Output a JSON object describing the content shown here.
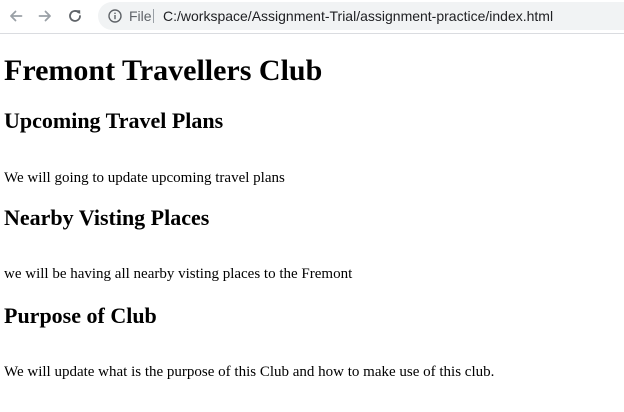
{
  "browser": {
    "back_icon": "arrow-left-icon",
    "forward_icon": "arrow-right-icon",
    "reload_icon": "reload-icon",
    "info_icon": "info-icon",
    "scheme_label": "File",
    "url": "C:/workspace/Assignment-Trial/assignment-practice/index.html"
  },
  "page": {
    "title": "Fremont Travellers Club",
    "sections": [
      {
        "heading": "Upcoming Travel Plans",
        "text": "We will going to update upcoming travel plans"
      },
      {
        "heading": "Nearby Visting Places",
        "text": "we will be having all nearby visting places to the Fremont"
      },
      {
        "heading": "Purpose of Club",
        "text": "We will update what is the purpose of this Club and how to make use of this club."
      }
    ]
  }
}
